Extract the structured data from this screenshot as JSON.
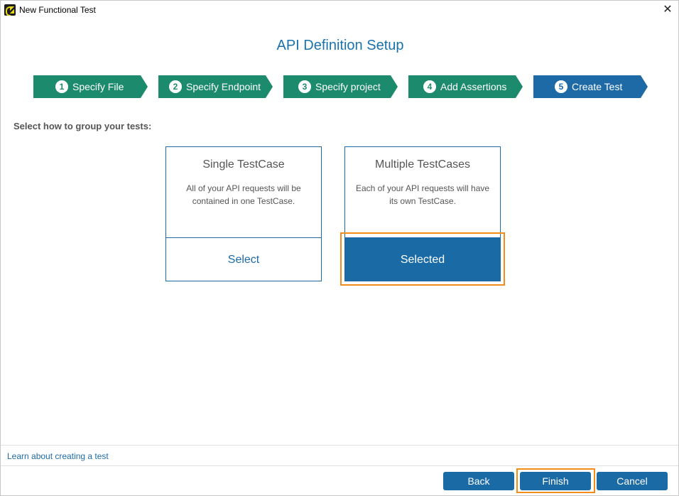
{
  "window": {
    "title": "New Functional Test",
    "close_glyph": "✕"
  },
  "heading": "API Definition Setup",
  "steps": [
    {
      "number": "1",
      "label": "Specify File"
    },
    {
      "number": "2",
      "label": "Specify Endpoint"
    },
    {
      "number": "3",
      "label": "Specify project"
    },
    {
      "number": "4",
      "label": "Add Assertions"
    },
    {
      "number": "5",
      "label": "Create Test"
    }
  ],
  "step_colors": {
    "done": "#1c8a6c",
    "active": "#1e6aa7"
  },
  "prompt": "Select how to group your tests:",
  "options": [
    {
      "title": "Single TestCase",
      "description": "All of your API requests will be contained in one TestCase.",
      "button": "Select",
      "selected": false
    },
    {
      "title": "Multiple TestCases",
      "description": "Each of your API requests will have its own TestCase.",
      "button": "Selected",
      "selected": true
    }
  ],
  "footer": {
    "link": "Learn about creating a test",
    "back": "Back",
    "finish": "Finish",
    "cancel": "Cancel"
  },
  "accent": "#1a6aa6",
  "highlight_color": "#f28c1a"
}
